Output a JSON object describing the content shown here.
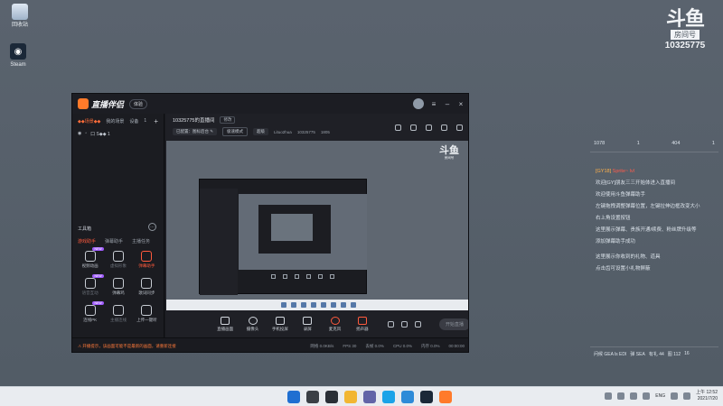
{
  "desktop": {
    "icons": [
      {
        "label": "回收站",
        "icon": "recycle-bin-icon"
      },
      {
        "label": "Steam",
        "icon": "steam-icon"
      }
    ],
    "brand": {
      "logo": "斗鱼",
      "sub": "房间号",
      "room": "10325775"
    }
  },
  "chat": {
    "stats": [
      "1078",
      "1",
      "404",
      "1"
    ],
    "lines": [
      {
        "tag": "[GY18]",
        "name": "Sprite~ lvl",
        "text": ""
      },
      {
        "tag": "",
        "name": "",
        "text": "欢迎[GY]朋友三三开始体进入直播间"
      },
      {
        "tag": "",
        "name": "",
        "text": "欢迎使用斗鱼弹幕助手"
      },
      {
        "tag": "",
        "name": "",
        "text": "左键拖拽调整弹幕位置，左键拉伸边框改变大小"
      },
      {
        "tag": "",
        "name": "",
        "text": "右上角设置按钮"
      },
      {
        "tag": "",
        "name": "",
        "text": "这里展示弹幕、贵族开通/续费、粉丝牌升级等"
      },
      {
        "tag": "",
        "name": "",
        "text": "添加弹幕助手成功"
      },
      {
        "tag": "",
        "name": "",
        "text": "这里展示你收到的礼物、道具"
      },
      {
        "tag": "",
        "name": "",
        "text": "点击齿可设置小礼物屏蔽"
      }
    ],
    "footer": [
      "问候 GEA ls EDI",
      "弹 SEA",
      "有礼 44",
      "图 112",
      "16"
    ]
  },
  "app": {
    "title": "直播伴侣",
    "version_chip": "体验",
    "sidebar": {
      "scene": "◆◆场景◆◆",
      "tabs": [
        "我的场景",
        "设备",
        "1"
      ],
      "source": "口 S◆◆ 1",
      "tools_title": "工具箱",
      "tools_tabs": [
        "游戏助手",
        "弹幕助手",
        "主播任务"
      ],
      "tools": [
        {
          "label": "视频动画",
          "icon": "video-effect-icon",
          "new": "NEW",
          "state": "normal"
        },
        {
          "label": "虚拟形象",
          "icon": "avatar-icon",
          "new": "",
          "state": "dim"
        },
        {
          "label": "弹幕助手",
          "icon": "danmaku-icon",
          "new": "",
          "state": "hot"
        },
        {
          "label": "语音互动",
          "icon": "voice-icon",
          "new": "NEW",
          "state": "dim"
        },
        {
          "label": "弹幕鸡",
          "icon": "chicken-icon",
          "new": "",
          "state": "normal"
        },
        {
          "label": "歌词同步",
          "icon": "lyrics-icon",
          "new": "",
          "state": "normal"
        },
        {
          "label": "连线PK",
          "icon": "pk-icon",
          "new": "NEW",
          "state": "normal"
        },
        {
          "label": "主播连线",
          "icon": "link-icon",
          "new": "",
          "state": "dim"
        },
        {
          "label": "上传一键听",
          "icon": "upload-icon",
          "new": "",
          "state": "normal"
        }
      ]
    },
    "main": {
      "room_title": "10325775的直播间",
      "edit_label": "修改",
      "category": "已配置：图标后台 ✎",
      "stream_mode": "极速模式",
      "quality": "超级",
      "user": "Lituo2hua",
      "room_id": "10325775",
      "fans": "1805",
      "preview": {
        "logo": "斗鱼",
        "logo_sub": "房间号"
      },
      "controls": [
        {
          "label": "直播画面",
          "icon": "screen-icon",
          "state": "normal"
        },
        {
          "label": "摄像头",
          "icon": "camera-icon",
          "state": "normal"
        },
        {
          "label": "手机投屏",
          "icon": "phone-cast-icon",
          "state": "normal"
        },
        {
          "label": "录屏",
          "icon": "record-icon",
          "state": "normal"
        },
        {
          "label": "麦克风",
          "icon": "mic-icon",
          "state": "hot"
        },
        {
          "label": "扬声器",
          "icon": "speaker-icon",
          "state": "hot"
        }
      ],
      "start_label": "开始直播"
    },
    "status": {
      "warning": "⚠ 开播提示，该画面可能不是最新的画面，请重新连接",
      "items": [
        "网络 0.0KB/s",
        "FPS 30",
        "丢帧 0.0%",
        "CPU 0.0%",
        "内存 0.0%",
        "00:00:00"
      ]
    }
  },
  "taskbar": {
    "tray_lang": "ENG",
    "time": "上午 12:52",
    "date": "2021/7/20"
  }
}
